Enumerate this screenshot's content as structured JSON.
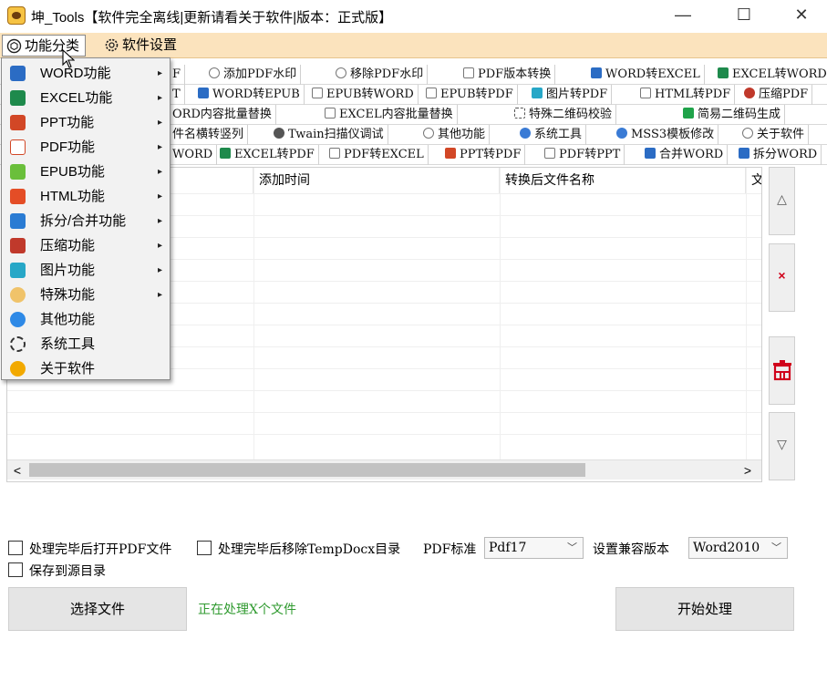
{
  "window": {
    "title": "坤_Tools【软件完全离线|更新请看关于软件|版本：正式版】",
    "minimize": "—",
    "maximize": "☐",
    "close": "✕"
  },
  "menubar": {
    "category": "功能分类",
    "settings": "软件设置"
  },
  "toolbar": {
    "row1": [
      "F",
      "添加PDF水印",
      "移除PDF水印",
      "PDF版本转换",
      "WORD转EXCEL",
      "EXCEL转WORD"
    ],
    "row2": [
      "T",
      "WORD转EPUB",
      "EPUB转WORD",
      "EPUB转PDF",
      "图片转PDF",
      "HTML转PDF",
      "压缩PDF"
    ],
    "row3": [
      "ORD内容批量替换",
      "EXCEL内容批量替换",
      "特殊二维码校验",
      "简易二维码生成"
    ],
    "row4": [
      "件名横转竖列",
      "Twain扫描仪调试",
      "其他功能",
      "系统工具",
      "MSS3模板修改",
      "关于软件"
    ],
    "row5": [
      "WORD",
      "EXCEL转PDF",
      "PDF转EXCEL",
      "PPT转PDF",
      "PDF转PPT",
      "合并WORD",
      "拆分WORD"
    ]
  },
  "table": {
    "columns": [
      "",
      "添加时间",
      "转换后文件名称",
      "文"
    ]
  },
  "side_buttons": {
    "up": "△",
    "delete": "×",
    "clear": "🗑",
    "down": "▽"
  },
  "scrollbar": {
    "left": "<",
    "right": ">"
  },
  "options": {
    "open_pdf_after": "处理完毕后打开PDF文件",
    "remove_temp_after": "处理完毕后移除TempDocx目录",
    "pdf_standard_label": "PDF标准",
    "pdf_standard_value": "Pdf17",
    "compat_label": "设置兼容版本",
    "compat_value": "Word2010",
    "save_to_source": "保存到源目录"
  },
  "actions": {
    "select_file": "选择文件",
    "status": "正在处理X个文件",
    "start": "开始处理"
  },
  "dropdown": {
    "items": [
      {
        "label": "WORD功能",
        "icon": "word-icon",
        "color": "#2b6cc4",
        "submenu": true
      },
      {
        "label": "EXCEL功能",
        "icon": "excel-icon",
        "color": "#1e8a4c",
        "submenu": true
      },
      {
        "label": "PPT功能",
        "icon": "ppt-icon",
        "color": "#d24726",
        "submenu": true
      },
      {
        "label": "PDF功能",
        "icon": "pdf-icon",
        "color": "#ffffff",
        "submenu": true
      },
      {
        "label": "EPUB功能",
        "icon": "epub-icon",
        "color": "#6abf3b",
        "submenu": true
      },
      {
        "label": "HTML功能",
        "icon": "html5-icon",
        "color": "#e44d26",
        "submenu": true
      },
      {
        "label": "拆分/合并功能",
        "icon": "scissors-icon",
        "color": "#2a7bd3",
        "submenu": true
      },
      {
        "label": "压缩功能",
        "icon": "compress-icon",
        "color": "#c0392b",
        "submenu": true
      },
      {
        "label": "图片功能",
        "icon": "image-icon",
        "color": "#27a7c7",
        "submenu": true
      },
      {
        "label": "特殊功能",
        "icon": "cloud-icon",
        "color": "#f0c36a",
        "submenu": true
      },
      {
        "label": "其他功能",
        "icon": "more-icon",
        "color": "#2e89e6",
        "submenu": false
      },
      {
        "label": "系统工具",
        "icon": "gear-icon",
        "color": "#333333",
        "submenu": false
      },
      {
        "label": "关于软件",
        "icon": "info-icon",
        "color": "#f2a900",
        "submenu": false
      }
    ],
    "arrow": "▸"
  }
}
